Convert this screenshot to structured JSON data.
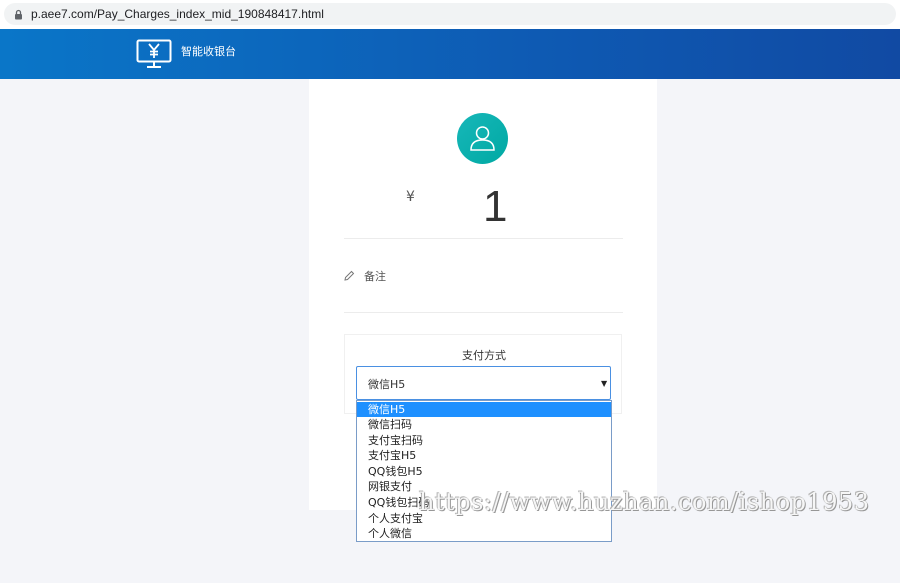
{
  "browser": {
    "url": "p.aee7.com/Pay_Charges_index_mid_190848417.html",
    "lock_icon": "lock-icon"
  },
  "header": {
    "brand": "智能收银台",
    "logo_icon": "yen-monitor-icon",
    "colors": {
      "gradient_start": "#0a76c8",
      "gradient_end": "#114aa3"
    }
  },
  "card": {
    "avatar_icon": "user-icon",
    "avatar_color": "#17b7b9",
    "currency_symbol": "¥",
    "amount": "1",
    "remark_icon": "pencil-icon",
    "remark_label": "备注"
  },
  "payment": {
    "label": "支付方式",
    "selected": "微信H5",
    "options": [
      "微信H5",
      "微信扫码",
      "支付宝扫码",
      "支付宝H5",
      "QQ钱包H5",
      "网银支付",
      "QQ钱包扫码",
      "个人支付宝",
      "个人微信"
    ],
    "highlight_color": "#1e90ff"
  },
  "watermark": "https://www.huzhan.com/ishop1953"
}
